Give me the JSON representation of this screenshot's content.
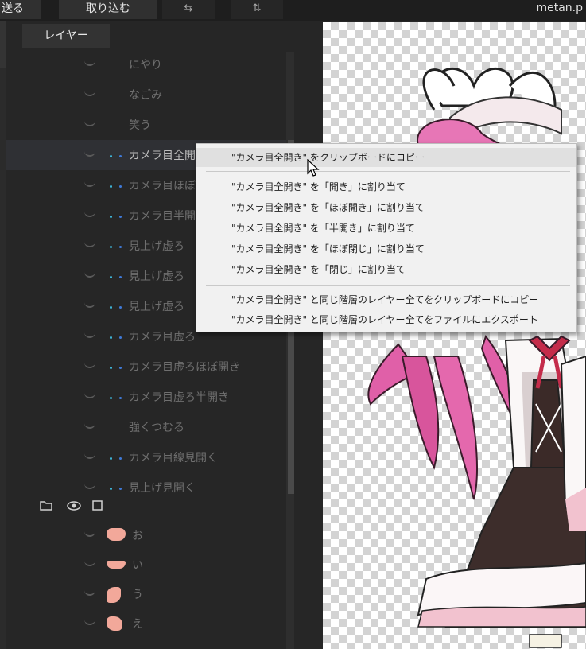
{
  "toolbar": {
    "send_label": "送る",
    "import_label": "取り込む",
    "swap_icon_1": "⇆",
    "swap_icon_2": "⇅",
    "file_name": "metan.p"
  },
  "panel": {
    "tab_label": "レイヤー",
    "layers": [
      {
        "name": "にやり",
        "selected": false,
        "dots": 0
      },
      {
        "name": "なごみ",
        "selected": false,
        "dots": 0
      },
      {
        "name": "笑う",
        "selected": false,
        "dots": 0
      },
      {
        "name": "カメラ目全開き",
        "selected": true,
        "dots": 2
      },
      {
        "name": "カメラ目ほぼ開き",
        "selected": false,
        "dots": 2
      },
      {
        "name": "カメラ目半開き",
        "selected": false,
        "dots": 2
      },
      {
        "name": "見上げ虚ろ",
        "selected": false,
        "dots": 2
      },
      {
        "name": "見上げ虚ろ",
        "selected": false,
        "dots": 2
      },
      {
        "name": "見上げ虚ろ",
        "selected": false,
        "dots": 2
      },
      {
        "name": "カメラ目虚ろ",
        "selected": false,
        "dots": 2
      },
      {
        "name": "カメラ目虚ろほぼ開き",
        "selected": false,
        "dots": 2
      },
      {
        "name": "カメラ目虚ろ半開き",
        "selected": false,
        "dots": 2
      },
      {
        "name": "強くつむる",
        "selected": false,
        "dots": 0
      },
      {
        "name": "カメラ目線見開く",
        "selected": false,
        "dots": 2
      },
      {
        "name": "見上げ見開く",
        "selected": false,
        "dots": 2
      }
    ],
    "mouth_layers": [
      "お",
      "い",
      "う",
      "え"
    ]
  },
  "context_menu": {
    "items": [
      "\"カメラ目全開き\" をクリップボードにコピー",
      "\"カメラ目全開き\" を「開き」に割り当て",
      "\"カメラ目全開き\" を「ほぼ開き」に割り当て",
      "\"カメラ目全開き\" を「半開き」に割り当て",
      "\"カメラ目全開き\" を「ほぼ閉じ」に割り当て",
      "\"カメラ目全開き\" を「閉じ」に割り当て",
      "\"カメラ目全開き\" と同じ階層のレイヤー全てをクリップボードにコピー",
      "\"カメラ目全開き\" と同じ階層のレイヤー全てをファイルにエクスポート"
    ]
  },
  "colors": {
    "accent_cyan": "#3fb7d9",
    "accent_blue": "#3f7ad9",
    "skin": "#f2a89a",
    "hair": "#e060a8"
  },
  "icons": [
    "folder-icon",
    "eye-icon",
    "checkbox-icon",
    "cursor-icon"
  ]
}
